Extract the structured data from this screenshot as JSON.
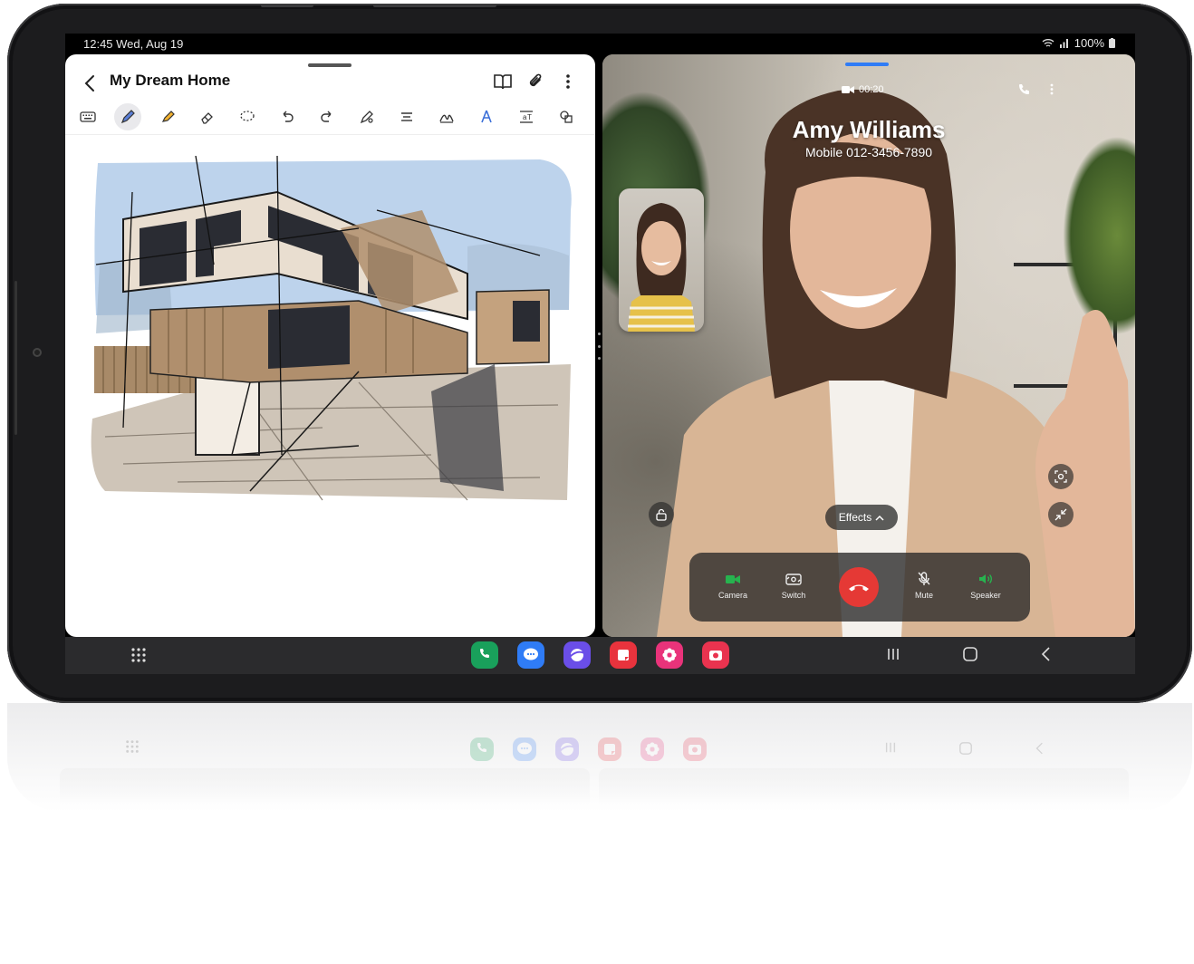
{
  "status_bar": {
    "time_date": "12:45  Wed, Aug 19",
    "battery": "100%"
  },
  "notes_app": {
    "title": "My Dream Home",
    "toolbar_tools": [
      "keyboard-icon",
      "pen-icon",
      "highlighter-icon",
      "eraser-icon",
      "lasso-icon",
      "undo-icon",
      "redo-icon",
      "pen-settings-icon",
      "align-icon",
      "handwriting-icon",
      "text-style-icon",
      "convert-text-icon",
      "shapes-icon"
    ],
    "active_tool": "pen-icon"
  },
  "call_app": {
    "timer": "00:20",
    "caller_name": "Amy Williams",
    "caller_number": "Mobile   012-3456-7890",
    "effects_label": "Effects",
    "controls": {
      "camera": "Camera",
      "switch": "Switch",
      "mute": "Mute",
      "speaker": "Speaker"
    },
    "accent_green": "#27b34f",
    "end_call_color": "#e53935"
  },
  "taskbar": {
    "apps": [
      {
        "name": "phone-app-icon",
        "color": "#19a05b"
      },
      {
        "name": "messages-app-icon",
        "color": "#2f7cf6"
      },
      {
        "name": "internet-app-icon",
        "color": "#6a4ee8"
      },
      {
        "name": "notes-app-icon",
        "color": "#e8333d"
      },
      {
        "name": "gallery-app-icon",
        "color": "#e9337a"
      },
      {
        "name": "camera-app-icon",
        "color": "#e9334f"
      }
    ]
  }
}
